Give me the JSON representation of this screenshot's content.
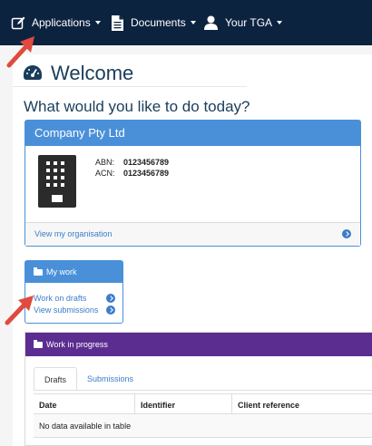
{
  "navbar": {
    "items": [
      {
        "label": "Applications",
        "icon": "edit-icon"
      },
      {
        "label": "Documents",
        "icon": "document-icon"
      },
      {
        "label": "Your TGA",
        "icon": "user-icon"
      }
    ]
  },
  "header": {
    "title": "Welcome",
    "question": "What would you like to do today?"
  },
  "company": {
    "name": "Company Pty Ltd",
    "abn_label": "ABN:",
    "abn_value": "0123456789",
    "acn_label": "ACN:",
    "acn_value": "0123456789",
    "link": "View my organisation"
  },
  "my_work": {
    "title": "My work",
    "links": [
      "Work on drafts",
      "View submissions"
    ]
  },
  "work_in_progress": {
    "title": "Work in progress",
    "tabs": [
      "Drafts",
      "Submissions"
    ],
    "active_tab": "Drafts",
    "columns": [
      "Date",
      "Identifier",
      "Client reference"
    ],
    "empty_message": "No data available in table"
  },
  "colors": {
    "navbar": "#0c2340",
    "panel_blue": "#4a90d9",
    "wip_purple": "#5c2d91",
    "annotation_red": "#e04a3f"
  }
}
